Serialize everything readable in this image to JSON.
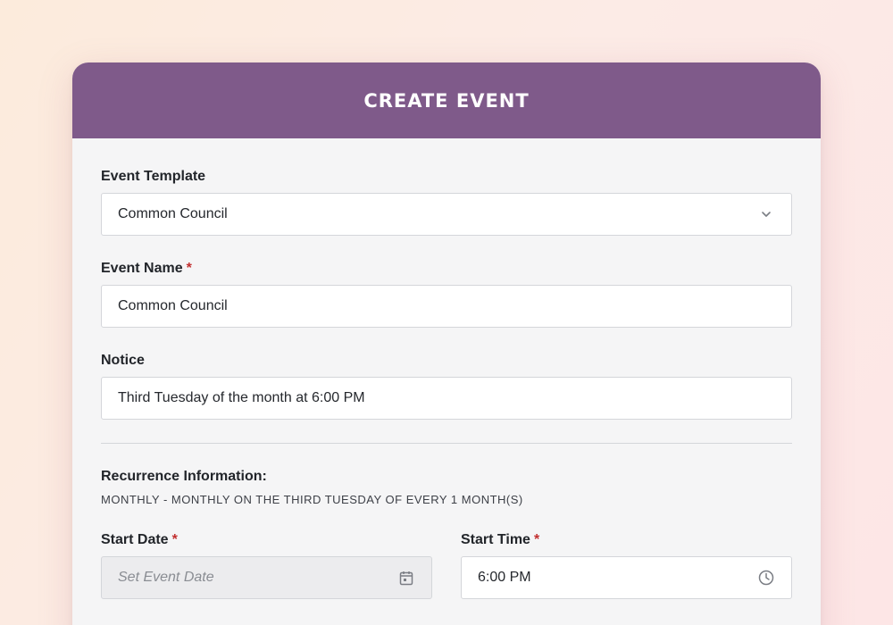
{
  "header": {
    "title": "CREATE EVENT"
  },
  "form": {
    "event_template": {
      "label": "Event Template",
      "value": "Common Council"
    },
    "event_name": {
      "label": "Event Name",
      "required_mark": "*",
      "value": "Common Council"
    },
    "notice": {
      "label": "Notice",
      "value": "Third Tuesday of the month at 6:00 PM"
    },
    "recurrence": {
      "label": "Recurrence Information:",
      "description": "MONTHLY - MONTHLY ON THE THIRD TUESDAY OF EVERY 1 MONTH(S)"
    },
    "start_date": {
      "label": "Start Date",
      "required_mark": "*",
      "placeholder": "Set Event Date",
      "icon": "calendar-icon"
    },
    "start_time": {
      "label": "Start Time",
      "required_mark": "*",
      "value": "6:00 PM",
      "icon": "clock-icon"
    }
  },
  "colors": {
    "header_bg": "#7f5a8a",
    "required": "#c22f2f",
    "card_bg": "#f5f5f6"
  }
}
